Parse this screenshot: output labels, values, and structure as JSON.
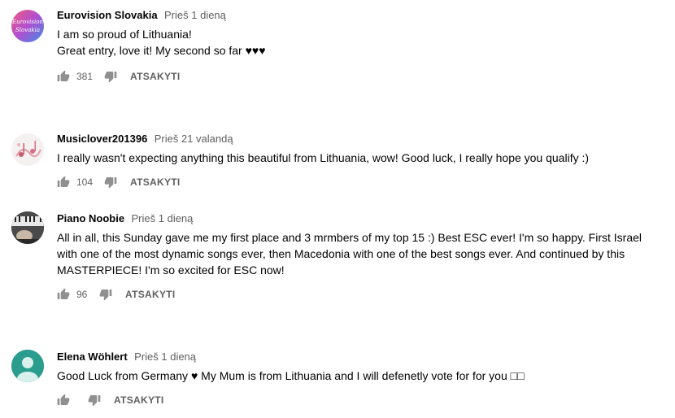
{
  "comments": [
    {
      "author": "Eurovision Slovakia",
      "time": "Prieš 1 dieną",
      "avatar_text": [
        "Eurovision",
        "Slovakia"
      ],
      "lines": [
        "I am so proud of Lithuania!",
        "Great entry, love it! My second so far ♥♥♥"
      ],
      "likes": "381",
      "reply": "ATSAKYTI"
    },
    {
      "author": "Musiclover201396",
      "time": "Prieš 21 valandą",
      "lines": [
        "I really wasn't expecting anything this beautiful from Lithuania, wow! Good luck, I really hope you qualify :)"
      ],
      "likes": "104",
      "reply": "ATSAKYTI"
    },
    {
      "author": "Piano Noobie",
      "time": "Prieš 1 dieną",
      "lines": [
        "All in all, this Sunday gave me my first place and 3 mrmbers of my top 15 :) Best ESC ever! I'm so happy. First Israel with one of the most dynamic songs ever, then Macedonia with one of the best songs ever. And continued by this MASTERPIECE! I'm so excited for ESC now!"
      ],
      "likes": "96",
      "reply": "ATSAKYTI"
    },
    {
      "author": "Elena Wöhlert",
      "time": "Prieš 1 dieną",
      "lines": [
        "Good Luck from Germany ♥ My Mum is from Lithuania and I will defenetly vote for for you □□"
      ],
      "likes": "",
      "reply": "ATSAKYTI"
    }
  ],
  "colors": {
    "text": "#030303",
    "muted": "#606060",
    "icon": "#909090",
    "avatar_teal": "#2a9d8f"
  },
  "icons": [
    "thumb-up-icon",
    "thumb-down-icon"
  ]
}
